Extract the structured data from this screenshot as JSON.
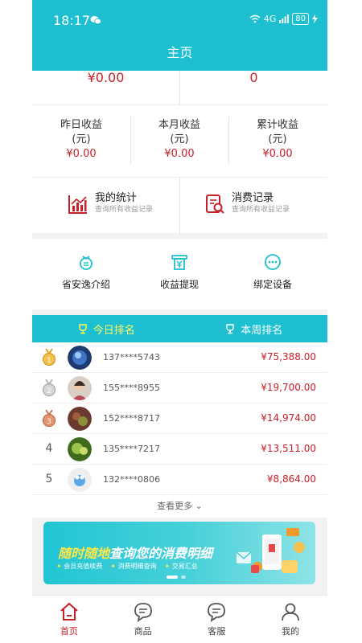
{
  "status_bar": {
    "time": "18:17",
    "network": "4G",
    "battery": "80"
  },
  "header": {
    "title": "主页"
  },
  "top_values": {
    "left": "¥0.00",
    "right": "0"
  },
  "earnings": [
    {
      "label": "昨日收益",
      "unit": "(元)",
      "value": "¥0.00"
    },
    {
      "label": "本月收益",
      "unit": "(元)",
      "value": "¥0.00"
    },
    {
      "label": "累计收益",
      "unit": "(元)",
      "value": "¥0.00"
    }
  ],
  "stats": [
    {
      "title": "我的统计",
      "subtitle": "查询所有收益记录",
      "icon": "bar-chart-icon"
    },
    {
      "title": "消费记录",
      "subtitle": "查询所有收益记录",
      "icon": "record-search-icon"
    }
  ],
  "services": [
    {
      "label": "省安逸介绍",
      "icon": "intro-icon"
    },
    {
      "label": "收益提现",
      "icon": "withdraw-icon"
    },
    {
      "label": "绑定设备",
      "icon": "more-dots-icon"
    }
  ],
  "rank_tabs": [
    {
      "label": "今日排名",
      "active": true
    },
    {
      "label": "本周排名",
      "active": false
    }
  ],
  "rankings": [
    {
      "rank": "1",
      "medal": "gold",
      "phone": "137****5743",
      "amount": "¥75,388.00"
    },
    {
      "rank": "2",
      "medal": "silver",
      "phone": "155****8955",
      "amount": "¥19,700.00"
    },
    {
      "rank": "3",
      "medal": "bronze",
      "phone": "152****8717",
      "amount": "¥14,974.00"
    },
    {
      "rank": "4",
      "medal": "",
      "phone": "135****7217",
      "amount": "¥13,511.00"
    },
    {
      "rank": "5",
      "medal": "",
      "phone": "132****0806",
      "amount": "¥8,864.00"
    }
  ],
  "more_label": "查看更多",
  "banner": {
    "title_part1": "随时随地",
    "title_part2": "查询您的消费明细",
    "tags": [
      "会员充值续费",
      "消费明细查询",
      "交易汇总"
    ]
  },
  "tabbar": [
    {
      "label": "首页",
      "active": true
    },
    {
      "label": "商品",
      "active": false
    },
    {
      "label": "客服",
      "active": false
    },
    {
      "label": "我的",
      "active": false
    }
  ],
  "colors": {
    "accent": "#1dbfd1",
    "price_red": "#c8202a",
    "tab_active_yellow": "#fffd62"
  }
}
